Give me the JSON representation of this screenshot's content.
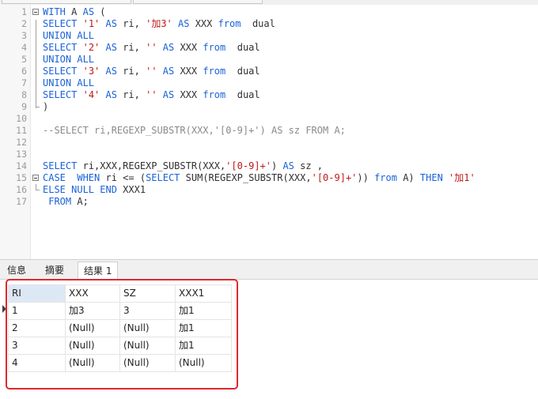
{
  "editor": {
    "lines": [
      {
        "n": "1",
        "fold": "start",
        "tokens": [
          {
            "t": "WITH",
            "c": "kw"
          },
          {
            "t": " A "
          },
          {
            "t": "AS",
            "c": "kw"
          },
          {
            "t": " ("
          }
        ]
      },
      {
        "n": "2",
        "tokens": [
          {
            "t": "SELECT",
            "c": "kw"
          },
          {
            "t": " "
          },
          {
            "t": "'1'",
            "c": "str"
          },
          {
            "t": " "
          },
          {
            "t": "AS",
            "c": "kw"
          },
          {
            "t": " ri, "
          },
          {
            "t": "'加3'",
            "c": "str"
          },
          {
            "t": " "
          },
          {
            "t": "AS",
            "c": "kw"
          },
          {
            "t": " XXX "
          },
          {
            "t": "from",
            "c": "kw"
          },
          {
            "t": "  dual"
          }
        ]
      },
      {
        "n": "3",
        "tokens": [
          {
            "t": "UNION ALL",
            "c": "kw"
          }
        ]
      },
      {
        "n": "4",
        "tokens": [
          {
            "t": "SELECT",
            "c": "kw"
          },
          {
            "t": " "
          },
          {
            "t": "'2'",
            "c": "str"
          },
          {
            "t": " "
          },
          {
            "t": "AS",
            "c": "kw"
          },
          {
            "t": " ri, "
          },
          {
            "t": "''",
            "c": "str"
          },
          {
            "t": " "
          },
          {
            "t": "AS",
            "c": "kw"
          },
          {
            "t": " XXX "
          },
          {
            "t": "from",
            "c": "kw"
          },
          {
            "t": "  dual"
          }
        ]
      },
      {
        "n": "5",
        "tokens": [
          {
            "t": "UNION ALL",
            "c": "kw"
          }
        ]
      },
      {
        "n": "6",
        "tokens": [
          {
            "t": "SELECT",
            "c": "kw"
          },
          {
            "t": " "
          },
          {
            "t": "'3'",
            "c": "str"
          },
          {
            "t": " "
          },
          {
            "t": "AS",
            "c": "kw"
          },
          {
            "t": " ri, "
          },
          {
            "t": "''",
            "c": "str"
          },
          {
            "t": " "
          },
          {
            "t": "AS",
            "c": "kw"
          },
          {
            "t": " XXX "
          },
          {
            "t": "from",
            "c": "kw"
          },
          {
            "t": "  dual"
          }
        ]
      },
      {
        "n": "7",
        "tokens": [
          {
            "t": "UNION ALL",
            "c": "kw"
          }
        ]
      },
      {
        "n": "8",
        "tokens": [
          {
            "t": "SELECT",
            "c": "kw"
          },
          {
            "t": " "
          },
          {
            "t": "'4'",
            "c": "str"
          },
          {
            "t": " "
          },
          {
            "t": "AS",
            "c": "kw"
          },
          {
            "t": " ri, "
          },
          {
            "t": "''",
            "c": "str"
          },
          {
            "t": " "
          },
          {
            "t": "AS",
            "c": "kw"
          },
          {
            "t": " XXX "
          },
          {
            "t": "from",
            "c": "kw"
          },
          {
            "t": "  dual"
          }
        ]
      },
      {
        "n": "9",
        "fold": "end",
        "tokens": [
          {
            "t": ")"
          }
        ]
      },
      {
        "n": "10",
        "tokens": []
      },
      {
        "n": "11",
        "tokens": [
          {
            "t": "--SELECT ri,REGEXP_SUBSTR(XXX,'[0-9]+') AS sz FROM A;",
            "c": "cmt"
          }
        ]
      },
      {
        "n": "12",
        "tokens": []
      },
      {
        "n": "13",
        "tokens": []
      },
      {
        "n": "14",
        "tokens": [
          {
            "t": "SELECT",
            "c": "kw"
          },
          {
            "t": " ri,XXX,REGEXP_SUBSTR(XXX,"
          },
          {
            "t": "'[0-9]+'",
            "c": "str"
          },
          {
            "t": ") "
          },
          {
            "t": "AS",
            "c": "kw"
          },
          {
            "t": " sz ,"
          }
        ]
      },
      {
        "n": "15",
        "fold": "start",
        "tokens": [
          {
            "t": "CASE",
            "c": "kw"
          },
          {
            "t": "  "
          },
          {
            "t": "WHEN",
            "c": "kw"
          },
          {
            "t": " ri <= ("
          },
          {
            "t": "SELECT",
            "c": "kw"
          },
          {
            "t": " SUM(REGEXP_SUBSTR(XXX,"
          },
          {
            "t": "'[0-9]+'",
            "c": "str"
          },
          {
            "t": ")) "
          },
          {
            "t": "from",
            "c": "kw"
          },
          {
            "t": " A) "
          },
          {
            "t": "THEN",
            "c": "kw"
          },
          {
            "t": " "
          },
          {
            "t": "'加1'",
            "c": "str"
          }
        ]
      },
      {
        "n": "16",
        "fold": "end",
        "tokens": [
          {
            "t": "ELSE NULL END",
            "c": "kw"
          },
          {
            "t": " XXX1"
          }
        ]
      },
      {
        "n": "17",
        "tokens": [
          {
            "t": " "
          },
          {
            "t": "FROM",
            "c": "kw"
          },
          {
            "t": " A;"
          }
        ]
      }
    ]
  },
  "tabs": [
    {
      "label": "信息"
    },
    {
      "label": "摘要"
    },
    {
      "label": "结果 1",
      "active": true
    }
  ],
  "results": {
    "columns": [
      "RI",
      "XXX",
      "SZ",
      "XXX1"
    ],
    "rows": [
      [
        "1",
        "加3",
        "3",
        "加1"
      ],
      [
        "2",
        "(Null)",
        "(Null)",
        "加1"
      ],
      [
        "3",
        "(Null)",
        "(Null)",
        "加1"
      ],
      [
        "4",
        "(Null)",
        "(Null)",
        "(Null)"
      ]
    ]
  },
  "colors": {
    "keyword": "#1a62d8",
    "string": "#c01818",
    "comment": "#8a8a8a",
    "highlight": "#e0282e"
  }
}
